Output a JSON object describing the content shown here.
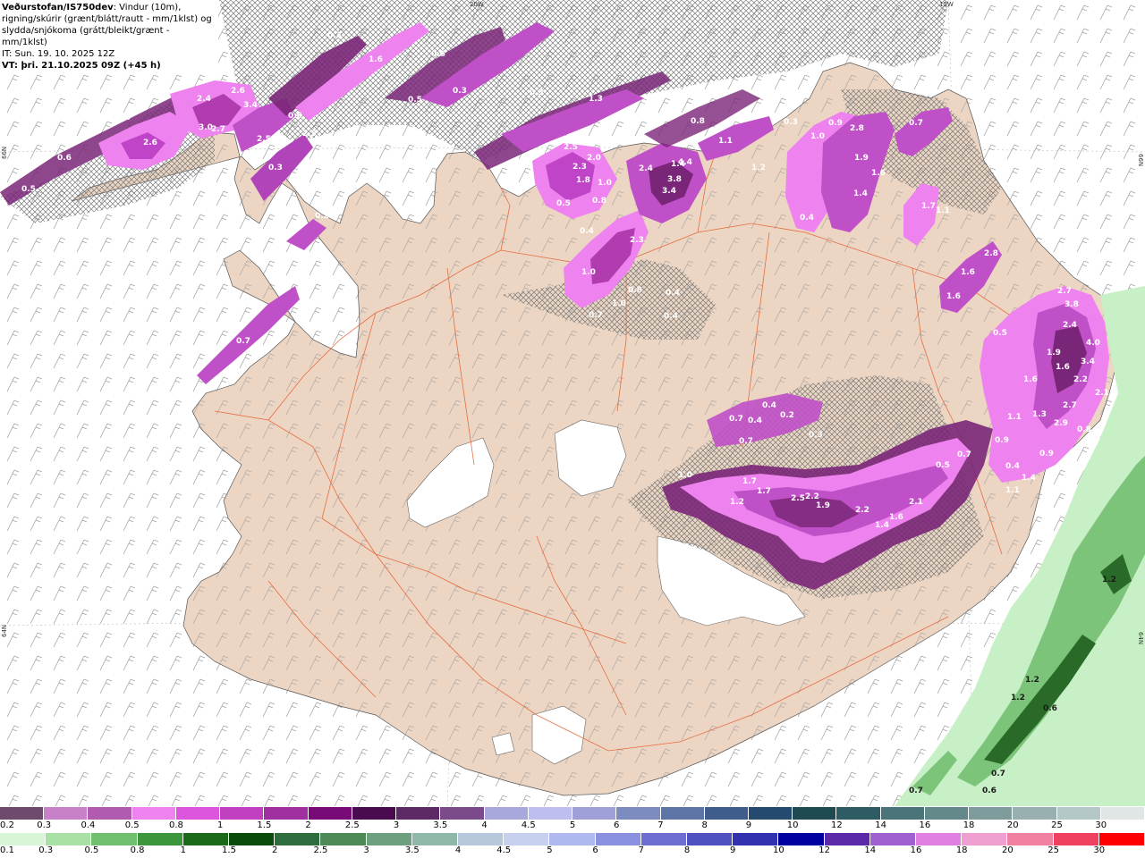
{
  "header": {
    "title_bold": "Veðurstofan/IS750dev",
    "title_rest": ": Vindur (10m),",
    "line2": "rigning/skúrir (grænt/blátt/rautt - mm/1klst) og",
    "line3": "slydda/snjókoma (grátt/bleikt/grænt - mm/1klst)",
    "it": "IT: Sun. 19. 10. 2025 12Z",
    "vt": "VT: þri. 21.10.2025 09Z (+45 h)"
  },
  "grid_labels": {
    "top_20w": "20W",
    "top_15w": "15W",
    "left_66n": "66N",
    "left_64n": "64N",
    "right_66n": "66N",
    "right_64n": "64N"
  },
  "precip_labels": {
    "nw": [
      "2.6",
      "3.0",
      "2.7",
      "2.4",
      "3.4",
      "2.6",
      "0.6",
      "0.5",
      "0.4",
      "2.5",
      "0.6",
      "2.5",
      "0.3",
      "0.2",
      "0.2",
      "0.3",
      "1.6",
      "0.6",
      "0.5",
      "0.3",
      "1.3",
      "0.8",
      "0.3",
      "0.7"
    ],
    "north": [
      "2.5",
      "2.0",
      "2.3",
      "1.8",
      "1.0",
      "0.5",
      "0.8",
      "0.4",
      "2.3",
      "1.0",
      "0.8",
      "1.0",
      "0.7",
      "2.4",
      "3.8",
      "3.4",
      "4.4",
      "0.4",
      "0.4",
      "1.1",
      "1.2",
      "1.3",
      "1.3",
      "1.4"
    ],
    "ne": [
      "0.9",
      "2.8",
      "1.0",
      "1.9",
      "1.6",
      "1.4",
      "0.4",
      "1.7",
      "1.1",
      "2.8",
      "1.6",
      "1.6",
      "0.3",
      "0.5",
      "0.7"
    ],
    "east": [
      "2.7",
      "3.8",
      "2.4",
      "4.0",
      "1.9",
      "3.4",
      "1.6",
      "2.2",
      "1.6",
      "2.1",
      "1.1",
      "1.3",
      "2.7",
      "2.9",
      "0.9",
      "0.9",
      "0.4",
      "1.4",
      "0.4",
      "1.1",
      "0.8"
    ],
    "se": [
      "1.0",
      "1.7",
      "1.7",
      "1.2",
      "2.5",
      "2.2",
      "1.9",
      "2.2",
      "1.4",
      "1.6",
      "2.1",
      "0.5",
      "0.7",
      "0.7",
      "0.4",
      "0.7",
      "0.4",
      "0.2",
      "0.3"
    ],
    "green": [
      "1.2",
      "1.2",
      "1.2",
      "0.6",
      "0.7",
      "0.7",
      "0.6"
    ]
  },
  "colors": {
    "land": "#ecd5c3",
    "sea": "#ffffff",
    "roads": "#e35b2a",
    "snow_light": "#ee82ee",
    "snow_mid": "#c044c8",
    "snow_dark": "#7a2678",
    "rain_light": "#c8f0c6",
    "rain_mid": "#7cc47a",
    "rain_dark": "#2a6a28",
    "hatch": "#888888"
  },
  "legend_snow": {
    "labels": [
      "0.2",
      "0.3",
      "0.4",
      "0.5",
      "0.8",
      "1",
      "1.5",
      "2",
      "2.5",
      "3",
      "3.5",
      "4",
      "4.5",
      "5",
      "6",
      "7",
      "8",
      "9",
      "10",
      "12",
      "14",
      "16",
      "18",
      "20",
      "25",
      "30"
    ],
    "colors": [
      "#6e4a6e",
      "#c880c8",
      "#b05ab0",
      "#ee82ee",
      "#dd55dd",
      "#c040c0",
      "#a030a0",
      "#780a78",
      "#4a0a50",
      "#5e2a66",
      "#7a4a8a",
      "#a8a8dc",
      "#bebef0",
      "#a0a0d8",
      "#7c8cc0",
      "#5c74a6",
      "#3e5c8c",
      "#244a70",
      "#1e4a52",
      "#2e5c64",
      "#4a7478",
      "#62888a",
      "#7e9c9c",
      "#98b0b0",
      "#b4c8c8",
      "#e0e6e6"
    ]
  },
  "legend_rain": {
    "labels": [
      "0.1",
      "0.3",
      "0.5",
      "0.8",
      "1",
      "1.5",
      "2",
      "2.5",
      "3",
      "3.5",
      "4",
      "4.5",
      "5",
      "6",
      "7",
      "8",
      "9",
      "10",
      "12",
      "14",
      "16",
      "18",
      "20",
      "25",
      "30"
    ],
    "colors": [
      "#d8f5d6",
      "#a8e0a6",
      "#70c070",
      "#3c963c",
      "#1a6a1a",
      "#0a4a0a",
      "#2e6e3e",
      "#4e8a58",
      "#6ea080",
      "#90b8a8",
      "#b8c8dc",
      "#c8d0f0",
      "#b0b8f0",
      "#8c90e0",
      "#6e6ed0",
      "#5050c0",
      "#3232b0",
      "#0000a0",
      "#5a2aa8",
      "#a060d0",
      "#e080e0",
      "#f0a0d0",
      "#f080a0",
      "#f04060",
      "#ff0000"
    ]
  }
}
